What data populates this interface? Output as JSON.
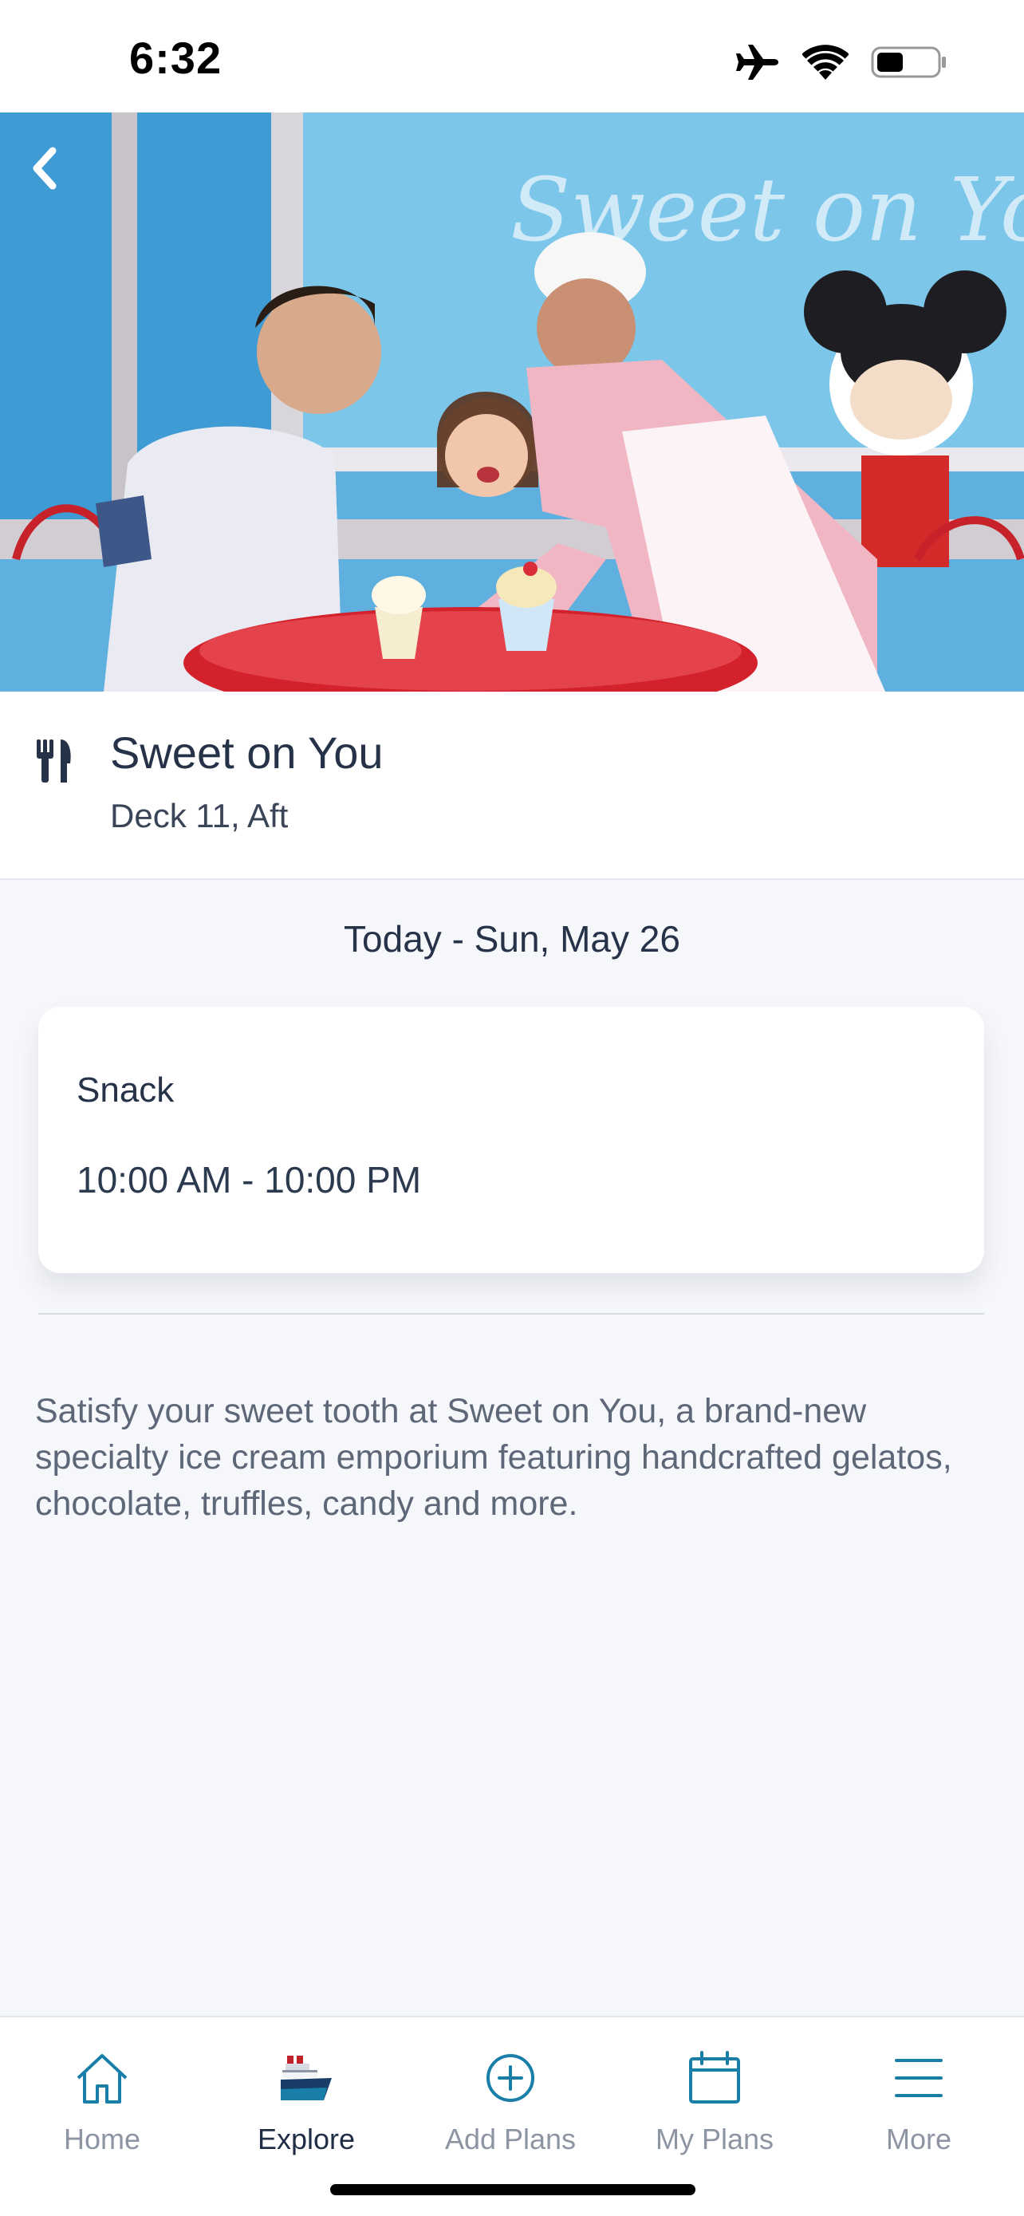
{
  "status_bar": {
    "time": "6:32",
    "icons": [
      "airplane-icon",
      "wifi-icon",
      "battery-icon"
    ]
  },
  "hero": {
    "image": "family-ice-cream-photo",
    "back_icon": "chevron-left-icon"
  },
  "venue": {
    "icon": "dining-utensils-icon",
    "title": "Sweet on You",
    "location": "Deck 11, Aft"
  },
  "schedule": {
    "date": "Today - Sun, May 26",
    "entries": [
      {
        "type": "Snack",
        "hours": "10:00 AM - 10:00 PM"
      }
    ]
  },
  "description": "Satisfy your sweet tooth at Sweet on You, a brand-new specialty ice cream emporium featuring handcrafted gelatos, chocolate, truffles, candy and more.",
  "tabs": [
    {
      "label": "Home",
      "icon": "home-icon",
      "active": false
    },
    {
      "label": "Explore",
      "icon": "ship-icon",
      "active": true
    },
    {
      "label": "Add Plans",
      "icon": "add-circle-icon",
      "active": false
    },
    {
      "label": "My Plans",
      "icon": "calendar-icon",
      "active": false
    },
    {
      "label": "More",
      "icon": "menu-icon",
      "active": false
    }
  ],
  "colors": {
    "accent": "#1a7fa8",
    "text_primary": "#253248",
    "text_secondary": "#5d6778",
    "tab_inactive": "#8d95a3",
    "background": "#f6f7fb"
  }
}
